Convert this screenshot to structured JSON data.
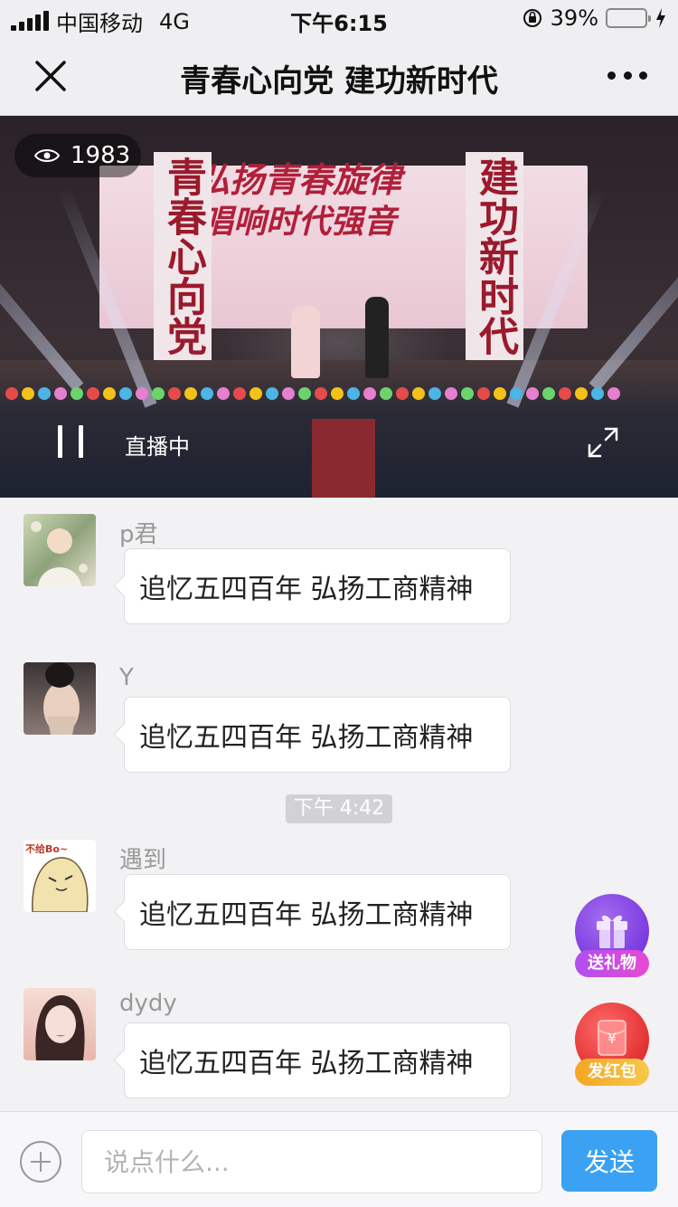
{
  "status_bar": {
    "carrier": "中国移动",
    "network": "4G",
    "time": "下午6:15",
    "battery_percent": "39%",
    "battery_level": 0.39,
    "battery_color": "#f3c21a"
  },
  "nav": {
    "title": "青春心向党 建功新时代",
    "close_icon": "close-icon",
    "more_icon": "more-dots-icon"
  },
  "video": {
    "viewer_count": "1983",
    "live_label": "直播中",
    "screen_title": "弘扬青春旋律",
    "screen_subtitle": "唱响时代强音",
    "banner_left": "青春心向党",
    "banner_right": "建功新时代"
  },
  "messages": [
    {
      "user": "p君",
      "text": "追忆五四百年 弘扬工商精神"
    },
    {
      "user": "Y",
      "text": "追忆五四百年 弘扬工商精神"
    },
    {
      "user": "遇到",
      "text": "追忆五四百年 弘扬工商精神"
    },
    {
      "user": "dydy",
      "text": "追忆五四百年 弘扬工商精神"
    }
  ],
  "time_separator": "下午 4:42",
  "avatar_stickers": {
    "meme_text": "不给Bo~"
  },
  "fabs": {
    "gift_label": "送礼物",
    "redpacket_label": "发红包",
    "redpacket_symbol": "¥"
  },
  "input_bar": {
    "placeholder": "说点什么...",
    "send_label": "发送",
    "accent_color": "#3aa1f3"
  }
}
